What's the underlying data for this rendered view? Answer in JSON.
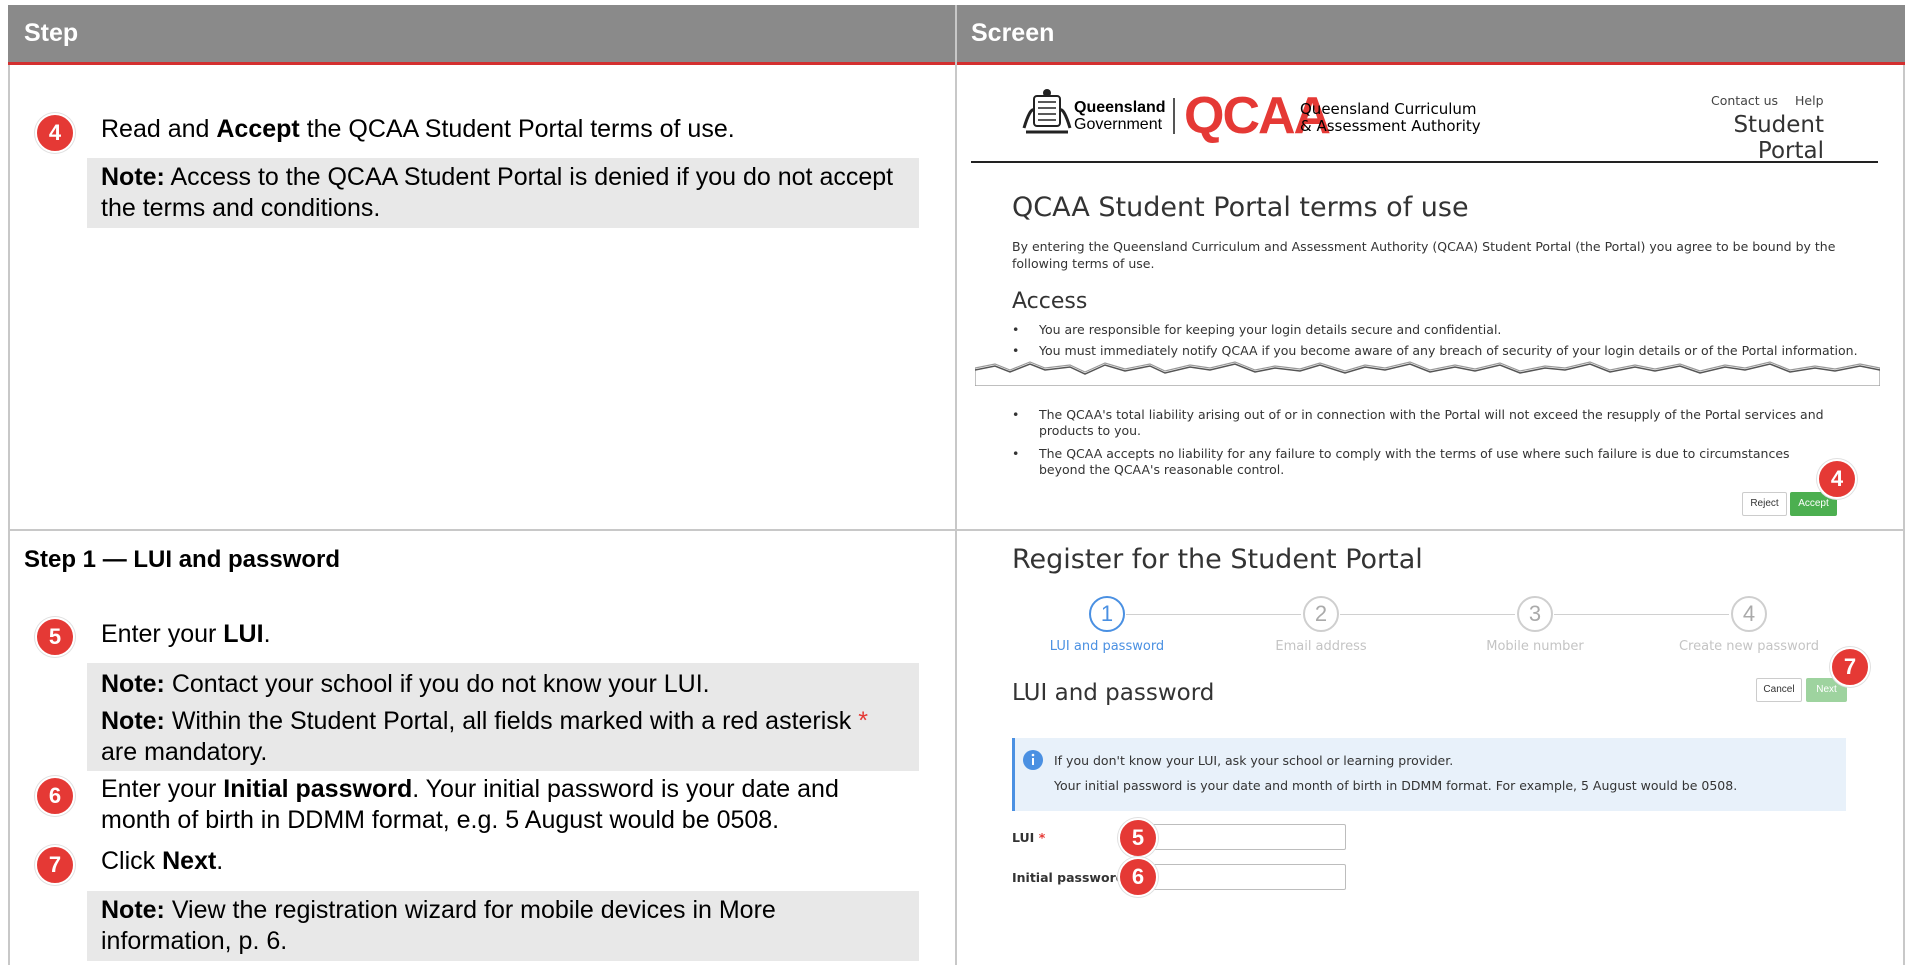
{
  "table": {
    "header_step": "Step",
    "header_screen": "Screen"
  },
  "row1": {
    "badge": "4",
    "instruction_prefix": "Read and ",
    "instruction_bold": "Accept",
    "instruction_suffix": " the QCAA Student Portal terms of use.",
    "note_label": "Note:",
    "note_text": " Access to the QCAA Student Portal is denied if you do not accept the terms and conditions."
  },
  "row2": {
    "section_title": "Step 1 — LUI and password",
    "step5": {
      "badge": "5",
      "prefix": "Enter your ",
      "bold": "LUI",
      "suffix": "."
    },
    "note1": {
      "label": "Note:",
      "text": " Contact your school if you do not know your LUI."
    },
    "note2": {
      "label": "Note:",
      "text": " Within the Student Portal, all fields marked with a red asterisk ",
      "asterisk": "*",
      "text2": " are mandatory."
    },
    "step6": {
      "badge": "6",
      "prefix": "Enter your ",
      "bold": "Initial password",
      "suffix": ". Your initial password is your date and month of birth in DDMM format, e.g. 5 August would be 0508."
    },
    "step7": {
      "badge": "7",
      "prefix": "Click ",
      "bold": "Next",
      "suffix": "."
    },
    "note3": {
      "label": "Note:",
      "text": " View the registration wizard for mobile devices in More information, p. 6."
    }
  },
  "portal": {
    "gov_name_line1": "Queensland",
    "gov_name_line2": "Government",
    "qcaa_logo": "QCAA",
    "qcaa_name_line1": "Queensland Curriculum",
    "qcaa_name_line2": "& Assessment Authority",
    "nav_contact": "Contact us",
    "nav_help": "Help",
    "portal_title": "Student Portal",
    "terms_heading": "QCAA Student Portal terms of use",
    "terms_intro": "By entering the Queensland Curriculum and Assessment Authority (QCAA) Student Portal (the Portal) you agree to be bound by the following terms of use.",
    "access_heading": "Access",
    "access_bullets": [
      "You are responsible for keeping your login details secure and confidential.",
      "You must immediately notify QCAA if you become aware of any breach of security of your login details or of the Portal information."
    ],
    "liability_bullets": [
      "The QCAA's total liability arising out of or in connection with the Portal will not exceed the resupply of the Portal services and products to you.",
      "The QCAA accepts no liability for any failure to comply with the terms of use where such failure is due to circumstances beyond the QCAA's reasonable control."
    ],
    "reject_label": "Reject",
    "accept_label": "Accept",
    "callout4": "4"
  },
  "register": {
    "title": "Register for the Student Portal",
    "steps": [
      {
        "num": "1",
        "label": "LUI and password"
      },
      {
        "num": "2",
        "label": "Email address"
      },
      {
        "num": "3",
        "label": "Mobile number"
      },
      {
        "num": "4",
        "label": "Create new password"
      }
    ],
    "section_heading": "LUI and password",
    "cancel_label": "Cancel",
    "next_label": "Next",
    "callout7": "7",
    "info_line1": "If you don't know your LUI, ask your school or learning provider.",
    "info_line2": "Your initial password is your date and month of birth in DDMM format. For example, 5 August would be 0508.",
    "lui_label": "LUI",
    "password_label": "Initial password",
    "asterisk": "*",
    "callout5": "5",
    "callout6": "6"
  }
}
